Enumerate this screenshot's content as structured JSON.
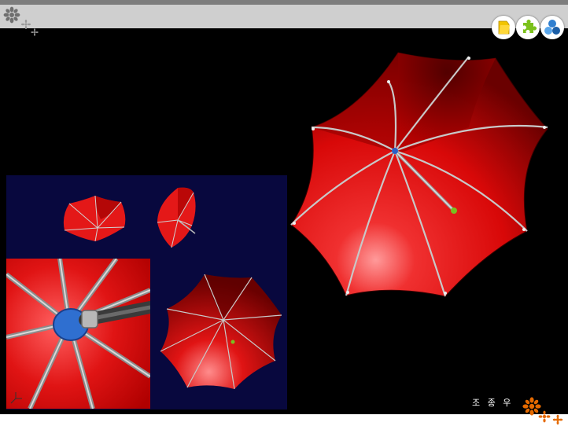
{
  "caption": {
    "text": "조 종 우"
  },
  "toolbar": {
    "buttons": [
      {
        "icon": "yellow-folder-icon",
        "color": "#f2c400"
      },
      {
        "icon": "green-puzzle-icon",
        "color": "#7bc11b"
      },
      {
        "icon": "blue-circles-icon",
        "color": "#2f7fd0"
      }
    ]
  },
  "colors": {
    "umbrella_red": "#e01010",
    "panel_background": "#08083e",
    "accent_orange": "#e56a00"
  }
}
